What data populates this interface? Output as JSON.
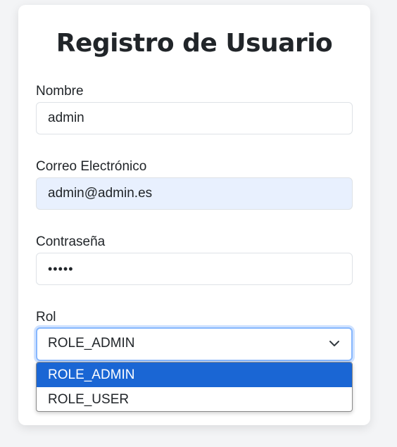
{
  "form": {
    "title": "Registro de Usuario",
    "name_label": "Nombre",
    "name_value": "admin",
    "email_label": "Correo Electrónico",
    "email_value": "admin@admin.es",
    "password_label": "Contraseña",
    "password_value": "•••••",
    "role_label": "Rol",
    "role_selected": "ROLE_ADMIN",
    "role_options": [
      "ROLE_ADMIN",
      "ROLE_USER"
    ]
  },
  "icons": {
    "select_arrow": "chevron-down-icon"
  },
  "colors": {
    "option_highlight": "#1a66d4",
    "autofill_background": "#e8f0fe",
    "focus_ring": "#86b7fe"
  }
}
